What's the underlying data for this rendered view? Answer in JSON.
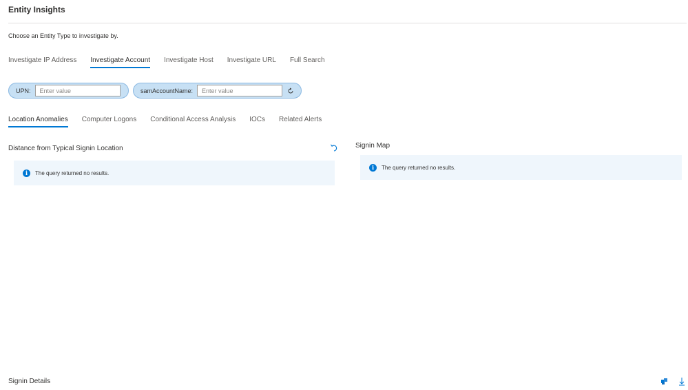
{
  "header": {
    "title": "Entity Insights",
    "instructions": "Choose an Entity Type to investigate by."
  },
  "entity_tabs": [
    {
      "label": "Investigate IP Address",
      "active": false
    },
    {
      "label": "Investigate Account",
      "active": true
    },
    {
      "label": "Investigate Host",
      "active": false
    },
    {
      "label": "Investigate URL",
      "active": false
    },
    {
      "label": "Full Search",
      "active": false
    }
  ],
  "parameters": {
    "upn": {
      "label": "UPN:",
      "placeholder": "Enter value",
      "value": ""
    },
    "sam": {
      "label": "samAccountName:",
      "placeholder": "Enter value",
      "value": ""
    }
  },
  "sub_tabs": [
    {
      "label": "Location Anomalies",
      "active": true
    },
    {
      "label": "Computer Logons",
      "active": false
    },
    {
      "label": "Conditional Access Analysis",
      "active": false
    },
    {
      "label": "IOCs",
      "active": false
    },
    {
      "label": "Related Alerts",
      "active": false
    }
  ],
  "left_panel": {
    "title": "Distance from Typical Signin Location",
    "message": "The query returned no results."
  },
  "right_panel": {
    "title": "Signin Map",
    "message": "The query returned no results."
  },
  "details": {
    "title": "Signin Details"
  },
  "icons": {
    "info": "info-icon",
    "refresh": "refresh-icon",
    "undo": "undo-icon",
    "export": "export-icon",
    "download": "download-icon"
  },
  "colors": {
    "accent": "#0078d4",
    "pill_bg": "#c7e0f4",
    "info_bg": "#eff6fc",
    "text": "#323130"
  }
}
